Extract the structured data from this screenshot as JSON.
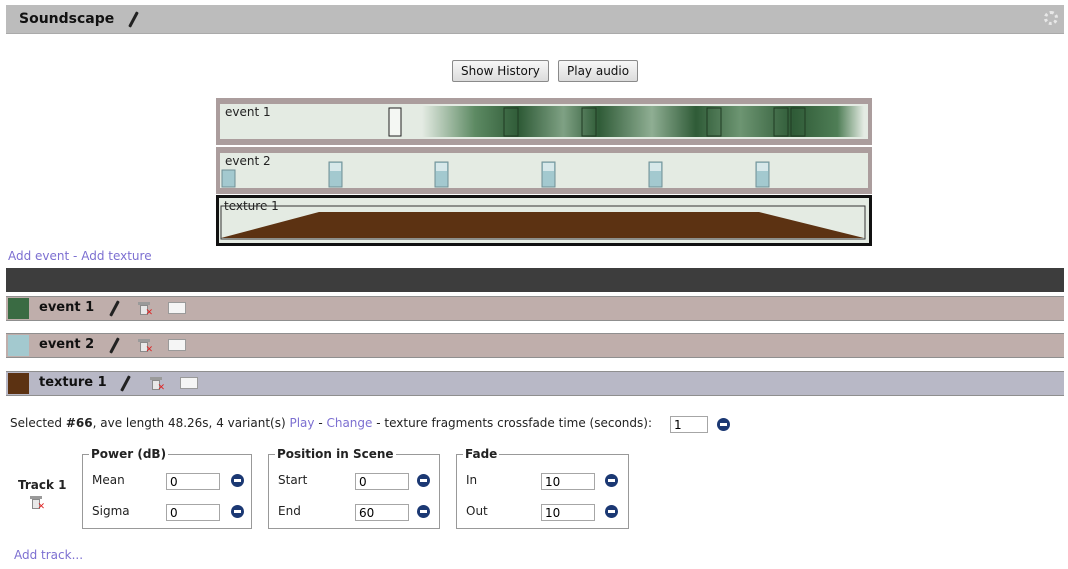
{
  "title": "Soundscape",
  "buttons": {
    "show_history": "Show History",
    "play_audio": "Play audio"
  },
  "timeline": {
    "lanes": [
      {
        "label": "event 1",
        "color": "#3a6b43"
      },
      {
        "label": "event 2",
        "color": "#a3c9cf"
      },
      {
        "label": "texture 1",
        "color": "#5c3212"
      }
    ]
  },
  "add_links": {
    "add_event": "Add event",
    "separator": " - ",
    "add_texture": "Add texture"
  },
  "sections": [
    {
      "name": "event 1",
      "color": "#3a6b43"
    },
    {
      "name": "event 2",
      "color": "#a3c9cf"
    },
    {
      "name": "texture 1",
      "color": "#5c3212"
    }
  ],
  "texture_info": {
    "selected_prefix": "Selected ",
    "selected_id": "#66",
    "details": ", ave length 48.26s, 4 variant(s) ",
    "play": "Play",
    "sep1": " - ",
    "change": "Change",
    "crossfade": " - texture fragments crossfade time (seconds):",
    "crossfade_value": "1"
  },
  "track": {
    "label": "Track 1",
    "power": {
      "legend": "Power (dB)",
      "mean_label": "Mean",
      "mean": "0",
      "sigma_label": "Sigma",
      "sigma": "0"
    },
    "position": {
      "legend": "Position in Scene",
      "start_label": "Start",
      "start": "0",
      "end_label": "End",
      "end": "60"
    },
    "fade": {
      "legend": "Fade",
      "in_label": "In",
      "in": "10",
      "out_label": "Out",
      "out": "10"
    }
  },
  "add_track": "Add track..."
}
